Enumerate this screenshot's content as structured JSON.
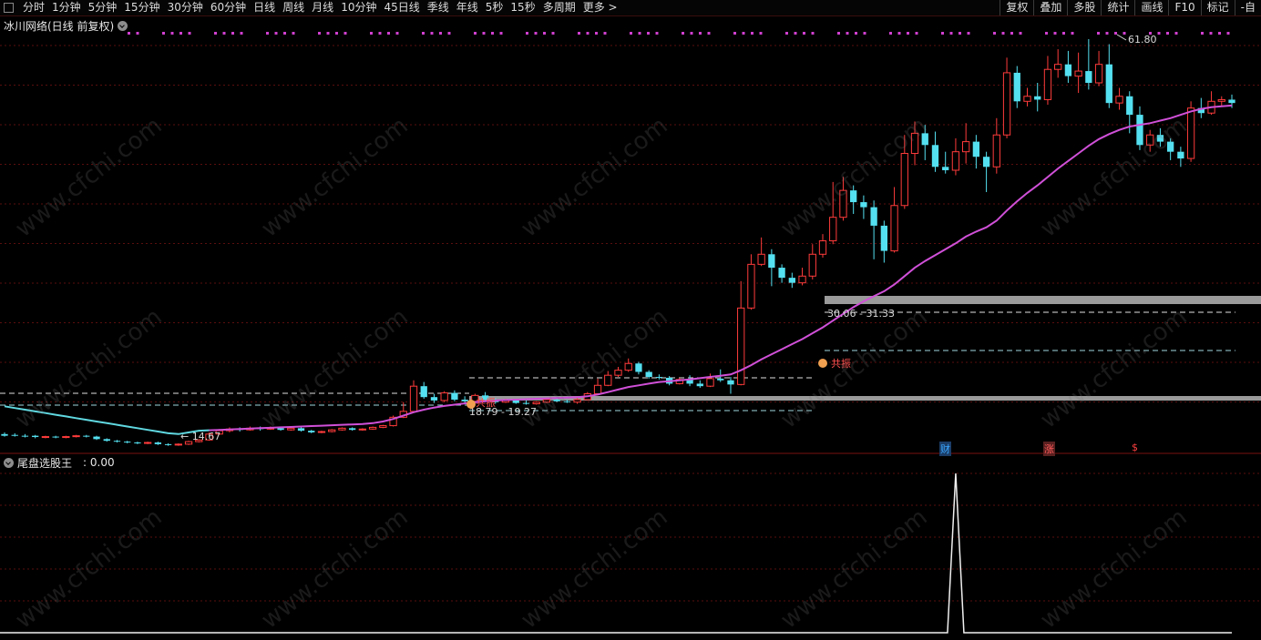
{
  "toolbar": {
    "items": [
      "分时",
      "1分钟",
      "5分钟",
      "15分钟",
      "30分钟",
      "60分钟",
      "日线",
      "周线",
      "月线",
      "10分钟",
      "45日线",
      "季线",
      "年线",
      "5秒",
      "15秒",
      "多周期",
      "更多 >"
    ],
    "right_items": [
      "复权",
      "叠加",
      "多股",
      "统计",
      "画线",
      "F10",
      "标记",
      "-自"
    ]
  },
  "chart": {
    "title": "冰川网络(日线 前复权)",
    "high_label": "61.80",
    "low_label": "14.67",
    "zone1_label": "30.06 - 31.33",
    "zone2_label": "18.79 - 19.27",
    "marker1_text": "共振",
    "marker2_text": "共振",
    "badges": [
      {
        "text": "财",
        "color": "#3aa7ff"
      },
      {
        "text": "涨",
        "color": "#ff5a5a"
      },
      {
        "text": "$",
        "color": "#ff4040"
      }
    ]
  },
  "indicator": {
    "name": "尾盘选股王",
    "value": ": 0.00"
  },
  "watermark": "www.cfchi.com",
  "colors": {
    "up": "#ff3b3b",
    "down": "#54e0f0",
    "ma": "#d050d8",
    "ma_early": "#60d8e0",
    "grid": "#5a0e0e",
    "dot": "#d040d0"
  },
  "price_axis": {
    "min": 14.67,
    "max": 61.8
  },
  "candles": [
    [
      14.8,
      14.6,
      15.0,
      14.5
    ],
    [
      14.7,
      14.6,
      14.9,
      14.5
    ],
    [
      14.6,
      14.5,
      14.8,
      14.4
    ],
    [
      14.6,
      14.45,
      14.7,
      14.3
    ],
    [
      14.45,
      14.5,
      14.6,
      14.3
    ],
    [
      14.5,
      14.45,
      14.6,
      14.3
    ],
    [
      14.4,
      14.5,
      14.6,
      14.3
    ],
    [
      14.5,
      14.6,
      14.7,
      14.4
    ],
    [
      14.6,
      14.5,
      14.7,
      14.4
    ],
    [
      14.5,
      14.2,
      14.6,
      14.1
    ],
    [
      14.2,
      14.0,
      14.3,
      13.9
    ],
    [
      14.0,
      13.9,
      14.1,
      13.8
    ],
    [
      13.9,
      13.8,
      14.0,
      13.7
    ],
    [
      13.8,
      13.7,
      13.9,
      13.6
    ],
    [
      13.7,
      13.8,
      13.9,
      13.6
    ],
    [
      13.8,
      13.6,
      13.9,
      13.5
    ],
    [
      13.6,
      13.5,
      13.7,
      13.4
    ],
    [
      13.5,
      13.6,
      13.7,
      13.4
    ],
    [
      13.6,
      13.9,
      14.0,
      13.5
    ],
    [
      13.9,
      14.1,
      14.2,
      13.8
    ],
    [
      14.1,
      14.8,
      15.0,
      14.0
    ],
    [
      14.8,
      15.2,
      15.4,
      14.7
    ],
    [
      15.2,
      15.4,
      15.6,
      15.0
    ],
    [
      15.4,
      15.3,
      15.6,
      15.1
    ],
    [
      15.3,
      15.5,
      15.7,
      15.2
    ],
    [
      15.5,
      15.4,
      15.7,
      15.2
    ],
    [
      15.4,
      15.5,
      15.7,
      15.3
    ],
    [
      15.5,
      15.3,
      15.6,
      15.2
    ],
    [
      15.3,
      15.5,
      15.6,
      15.2
    ],
    [
      15.5,
      15.2,
      15.6,
      15.1
    ],
    [
      15.2,
      15.0,
      15.3,
      14.9
    ],
    [
      15.0,
      15.1,
      15.2,
      14.9
    ],
    [
      15.1,
      15.3,
      15.4,
      15.0
    ],
    [
      15.3,
      15.5,
      15.6,
      15.2
    ],
    [
      15.5,
      15.3,
      15.6,
      15.2
    ],
    [
      15.3,
      15.4,
      15.5,
      15.2
    ],
    [
      15.4,
      15.6,
      15.7,
      15.3
    ],
    [
      15.6,
      15.8,
      15.9,
      15.5
    ],
    [
      15.8,
      16.8,
      17.0,
      15.7
    ],
    [
      16.8,
      17.5,
      18.6,
      16.7
    ],
    [
      17.5,
      20.5,
      21.2,
      17.4
    ],
    [
      20.5,
      19.2,
      21.0,
      19.0
    ],
    [
      19.2,
      18.8,
      19.6,
      18.5
    ],
    [
      18.8,
      19.7,
      19.9,
      18.6
    ],
    [
      19.7,
      18.9,
      20.0,
      18.7
    ],
    [
      18.9,
      18.7,
      19.3,
      18.5
    ],
    [
      18.7,
      19.4,
      19.6,
      18.5
    ],
    [
      19.4,
      18.8,
      19.8,
      18.6
    ],
    [
      18.8,
      18.6,
      19.1,
      18.4
    ],
    [
      18.6,
      18.8,
      19.0,
      18.5
    ],
    [
      18.8,
      18.5,
      19.0,
      18.4
    ],
    [
      18.5,
      18.4,
      18.8,
      18.3
    ],
    [
      18.4,
      18.6,
      18.7,
      18.3
    ],
    [
      18.6,
      18.9,
      19.1,
      18.5
    ],
    [
      18.9,
      18.7,
      19.1,
      18.6
    ],
    [
      18.7,
      18.6,
      18.9,
      18.5
    ],
    [
      18.6,
      18.9,
      19.2,
      18.4
    ],
    [
      18.9,
      19.6,
      19.8,
      18.8
    ],
    [
      19.6,
      20.6,
      21.4,
      19.5
    ],
    [
      20.6,
      21.8,
      22.3,
      20.5
    ],
    [
      21.8,
      22.4,
      22.8,
      21.6
    ],
    [
      22.4,
      23.2,
      23.8,
      22.2
    ],
    [
      23.2,
      22.2,
      23.4,
      21.9
    ],
    [
      22.2,
      21.6,
      22.4,
      21.4
    ],
    [
      21.6,
      21.5,
      21.9,
      21.3
    ],
    [
      21.5,
      20.8,
      21.7,
      20.6
    ],
    [
      20.8,
      21.3,
      21.5,
      20.7
    ],
    [
      21.3,
      20.8,
      21.8,
      20.5
    ],
    [
      20.8,
      20.5,
      21.2,
      20.3
    ],
    [
      20.5,
      21.4,
      22.0,
      20.4
    ],
    [
      21.4,
      21.2,
      22.5,
      21.0
    ],
    [
      21.2,
      20.7,
      21.6,
      19.6
    ],
    [
      20.7,
      29.8,
      33.0,
      20.6
    ],
    [
      29.8,
      35.0,
      36.2,
      29.6
    ],
    [
      35.0,
      36.2,
      38.2,
      34.8
    ],
    [
      36.2,
      34.6,
      36.8,
      32.4
    ],
    [
      34.6,
      33.4,
      35.0,
      32.8
    ],
    [
      33.4,
      32.8,
      34.0,
      32.2
    ],
    [
      32.8,
      33.6,
      34.6,
      32.5
    ],
    [
      33.6,
      36.2,
      37.4,
      33.2
    ],
    [
      36.2,
      37.8,
      38.6,
      35.8
    ],
    [
      37.8,
      40.6,
      44.8,
      37.4
    ],
    [
      40.6,
      43.8,
      45.4,
      40.2
    ],
    [
      43.8,
      42.4,
      44.4,
      41.0
    ],
    [
      42.4,
      41.8,
      43.2,
      40.4
    ],
    [
      41.8,
      39.6,
      42.6,
      35.6
    ],
    [
      39.6,
      36.6,
      40.2,
      35.2
    ],
    [
      36.6,
      42.0,
      44.2,
      36.4
    ],
    [
      42.0,
      48.2,
      50.4,
      41.6
    ],
    [
      48.2,
      50.6,
      52.0,
      46.8
    ],
    [
      50.6,
      49.2,
      51.6,
      47.4
    ],
    [
      49.2,
      46.6,
      50.8,
      46.0
    ],
    [
      46.6,
      46.2,
      48.4,
      45.8
    ],
    [
      46.2,
      48.4,
      50.0,
      45.6
    ],
    [
      48.4,
      49.6,
      51.8,
      47.0
    ],
    [
      49.6,
      47.8,
      50.4,
      46.4
    ],
    [
      47.8,
      46.6,
      48.4,
      43.6
    ],
    [
      46.6,
      50.4,
      52.4,
      45.8
    ],
    [
      50.4,
      57.8,
      59.6,
      50.0
    ],
    [
      57.8,
      54.4,
      58.6,
      53.6
    ],
    [
      54.4,
      55.0,
      56.0,
      53.8
    ],
    [
      55.0,
      54.6,
      56.6,
      53.2
    ],
    [
      54.6,
      58.2,
      59.8,
      54.0
    ],
    [
      58.2,
      58.8,
      60.6,
      57.2
    ],
    [
      58.8,
      57.4,
      60.4,
      56.6
    ],
    [
      57.4,
      58.0,
      60.2,
      55.4
    ],
    [
      58.0,
      56.6,
      61.8,
      55.8
    ],
    [
      56.6,
      58.8,
      60.4,
      56.2
    ],
    [
      58.8,
      54.2,
      61.2,
      53.6
    ],
    [
      54.2,
      55.0,
      56.0,
      53.4
    ],
    [
      55.0,
      52.8,
      55.6,
      50.6
    ],
    [
      52.8,
      49.2,
      53.8,
      48.6
    ],
    [
      49.2,
      50.4,
      51.0,
      48.4
    ],
    [
      50.4,
      49.6,
      51.2,
      49.0
    ],
    [
      49.6,
      48.4,
      50.0,
      47.4
    ],
    [
      48.4,
      47.6,
      49.0,
      46.6
    ],
    [
      47.6,
      53.6,
      54.4,
      47.2
    ],
    [
      53.6,
      53.0,
      54.8,
      52.4
    ],
    [
      53.0,
      54.4,
      55.6,
      52.8
    ],
    [
      54.4,
      54.6,
      55.0,
      53.8
    ],
    [
      54.6,
      54.2,
      55.2,
      53.6
    ]
  ],
  "ma": [
    18.1,
    17.9,
    17.7,
    17.5,
    17.3,
    17.1,
    16.9,
    16.7,
    16.5,
    16.3,
    16.1,
    15.9,
    15.7,
    15.5,
    15.3,
    15.1,
    14.9,
    14.8,
    15.0,
    15.2,
    15.25,
    15.3,
    15.35,
    15.4,
    15.45,
    15.5,
    15.55,
    15.6,
    15.65,
    15.7,
    15.75,
    15.8,
    15.85,
    15.9,
    15.95,
    16.0,
    16.1,
    16.3,
    16.6,
    17.0,
    17.4,
    17.7,
    17.95,
    18.15,
    18.3,
    18.45,
    18.6,
    18.7,
    18.8,
    18.85,
    18.9,
    18.95,
    19.0,
    19.05,
    19.1,
    19.15,
    19.2,
    19.3,
    19.5,
    19.8,
    20.1,
    20.4,
    20.6,
    20.8,
    21.0,
    21.1,
    21.2,
    21.3,
    21.45,
    21.6,
    21.75,
    21.9,
    22.4,
    23.0,
    23.7,
    24.3,
    24.9,
    25.5,
    26.1,
    26.8,
    27.5,
    28.3,
    29.1,
    29.9,
    30.6,
    31.2,
    31.8,
    32.6,
    33.6,
    34.6,
    35.4,
    36.1,
    36.8,
    37.5,
    38.3,
    38.9,
    39.4,
    40.2,
    41.4,
    42.5,
    43.5,
    44.4,
    45.4,
    46.4,
    47.3,
    48.2,
    49.1,
    49.9,
    50.5,
    51.0,
    51.4,
    51.6,
    51.8,
    52.1,
    52.4,
    52.8,
    53.2,
    53.5,
    53.7,
    53.8,
    53.9
  ],
  "signal_index": 93
}
